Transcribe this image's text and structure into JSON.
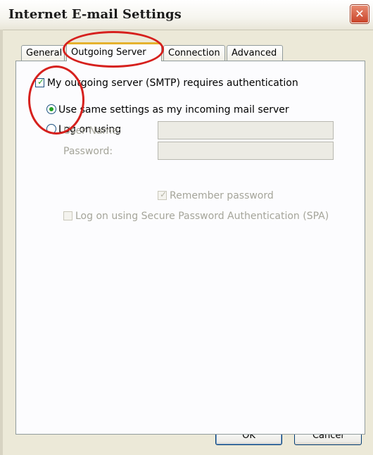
{
  "window": {
    "title": "Internet E-mail Settings",
    "close_glyph": "✕"
  },
  "tabs": [
    {
      "label": "General",
      "active": false
    },
    {
      "label": "Outgoing Server",
      "active": true
    },
    {
      "label": "Connection",
      "active": false
    },
    {
      "label": "Advanced",
      "active": false
    }
  ],
  "outgoing": {
    "requires_auth": {
      "label": "My outgoing server (SMTP) requires authentication",
      "checked": true
    },
    "use_same": {
      "label": "Use same settings as my incoming mail server",
      "selected": true
    },
    "log_on_using": {
      "label": "Log on using",
      "selected": false
    },
    "user_name": {
      "label": "User Name:",
      "value": ""
    },
    "password": {
      "label": "Password:",
      "value": ""
    },
    "remember": {
      "label": "Remember password",
      "checked": true,
      "enabled": false
    },
    "spa": {
      "label": "Log on using Secure Password Authentication (SPA)",
      "checked": false,
      "enabled": false
    }
  },
  "buttons": {
    "ok": "OK",
    "cancel": "Cancel"
  },
  "colors": {
    "accent_tab": "#e5b22f",
    "annotation": "#d6201d",
    "check": "#21a121"
  }
}
